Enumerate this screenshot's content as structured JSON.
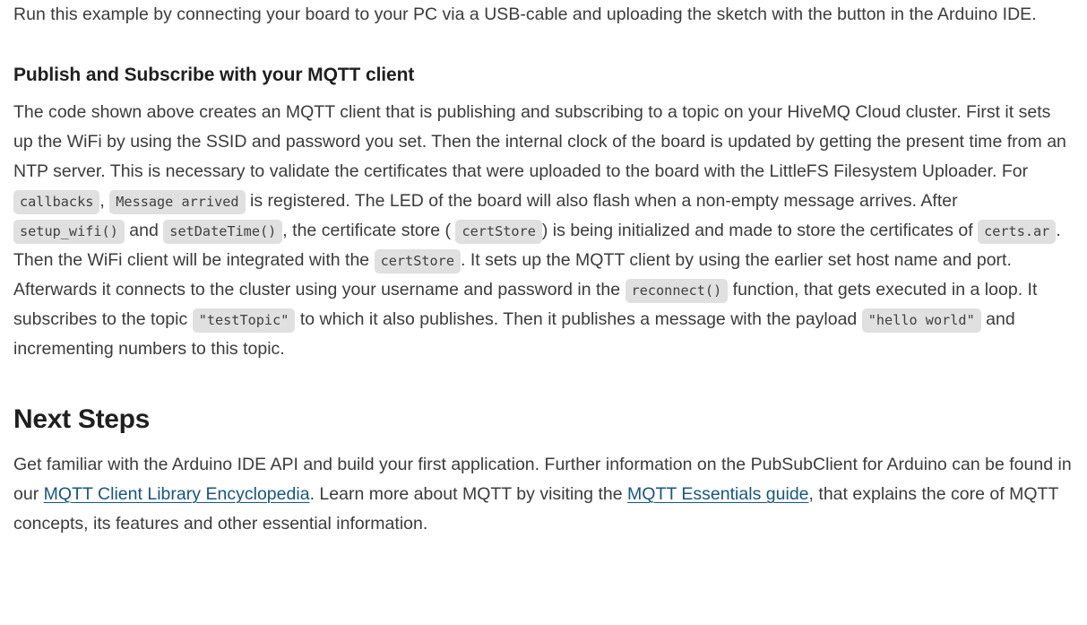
{
  "document": {
    "intro_paragraph": "Run this example by connecting your board to your PC via a USB-cable and uploading the sketch with the button in the Arduino IDE.",
    "section_publish": {
      "heading": "Publish and Subscribe with your MQTT client",
      "body": {
        "t1": "The code shown above creates an MQTT client that is publishing and subscribing to a topic on your HiveMQ Cloud cluster. First it sets up the WiFi by using the SSID and password you set. Then the internal clock of the board is updated by getting the present time from an NTP server. This is necessary to validate the certificates that were uploaded to the board with the LittleFS Filesystem Uploader. For ",
        "code1": "callbacks",
        "t2": ",",
        "code2": "Message arrived",
        "t3": " is registered. The LED of the board will also flash when a non-empty message arrives. After ",
        "code3": "setup_wifi()",
        "t4": "and",
        "code4": "setDateTime()",
        "t5": ", the certificate store (",
        "code5": "certStore",
        "t6": ") is being initialized and made to store the certificates of ",
        "code6": "certs.ar",
        "t7": ". Then the WiFi client will be integrated with the ",
        "code7": "certStore",
        "t8": ". It sets up the MQTT client by using the earlier set host name and port. Afterwards it connects to the cluster using your username and password in the ",
        "code8": "reconnect()",
        "t9": " function, that gets executed in a loop. It subscribes to the topic ",
        "code9": "\"testTopic\"",
        "t10": " to which it also publishes. Then it publishes a message with the payload ",
        "code10": "\"hello world\"",
        "t11": " and incrementing numbers to this topic."
      }
    },
    "section_next_steps": {
      "heading": "Next Steps",
      "body": {
        "t1": "Get familiar with the Arduino IDE API and build your first application. Further information on the PubSubClient for Arduino can be found in our ",
        "link1": "MQTT Client Library Encyclopedia",
        "t2": ". Learn more about MQTT by visiting the ",
        "link2": "MQTT Essentials guide",
        "t3": ", that explains the core of MQTT concepts, its features and other essential information."
      }
    }
  },
  "colors": {
    "body_text": "#3b3b3b",
    "heading_text": "#1f1f1f",
    "link": "#17567f",
    "code_background": "#e0e0e0",
    "code_text": "#404040",
    "page_background": "#ffffff"
  }
}
